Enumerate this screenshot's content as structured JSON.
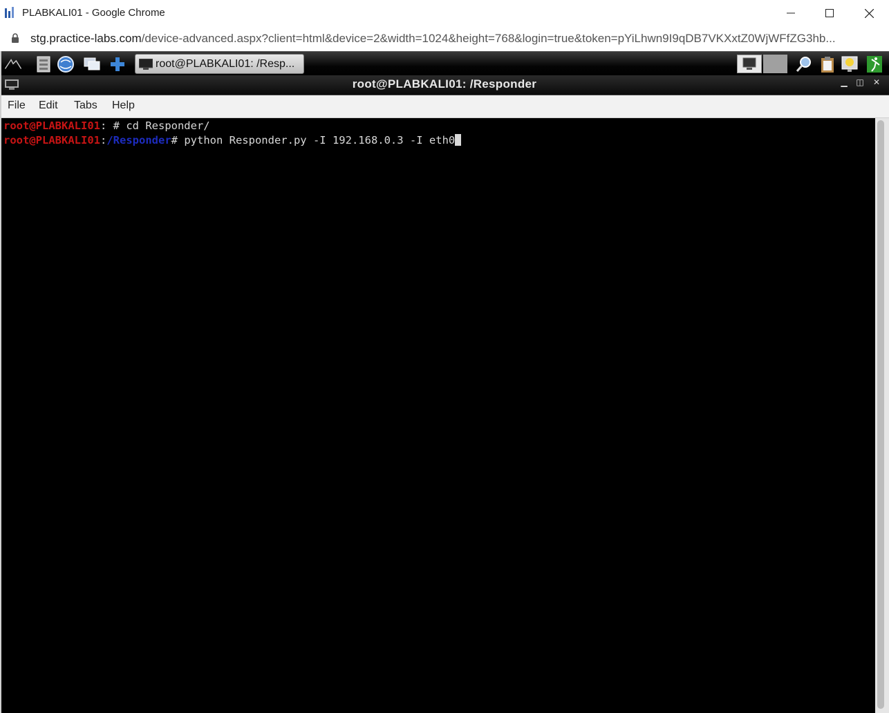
{
  "browser": {
    "window_title": "PLABKALI01 - Google Chrome",
    "url_host": "stg.practice-labs.com",
    "url_path": "/device-advanced.aspx?client=html&device=2&width=1024&height=768&login=true&token=pYiLhwn9I9qDB7VKXxtZ0WjWFfZG3hb..."
  },
  "panel": {
    "task_label": "root@PLABKALI01: /Resp...",
    "icons": [
      "kali-dragon-icon",
      "file-manager-icon",
      "browser-globe-icon",
      "windows-icon",
      "add-icon"
    ],
    "tray_icons": [
      "screen-icon",
      "magnifier-icon",
      "clipboard-icon",
      "lightbulb-icon",
      "exit-icon"
    ]
  },
  "terminal": {
    "title": "root@PLABKALI01: /Responder",
    "menu": [
      "File",
      "Edit",
      "Tabs",
      "Help"
    ],
    "lines": [
      {
        "user": "root@PLABKALI01",
        "sep": ":",
        "path": "",
        "cmd": " # cd Responder/"
      },
      {
        "user": "root@PLABKALI01",
        "sep": ":",
        "path": "/Responder",
        "cmd": "# python Responder.py -I 192.168.0.3 -I eth0"
      }
    ]
  },
  "colors": {
    "prompt_user": "#c81414",
    "prompt_path": "#1d2cbf",
    "terminal_bg": "#000000",
    "terminal_fg": "#d8d8d8"
  }
}
